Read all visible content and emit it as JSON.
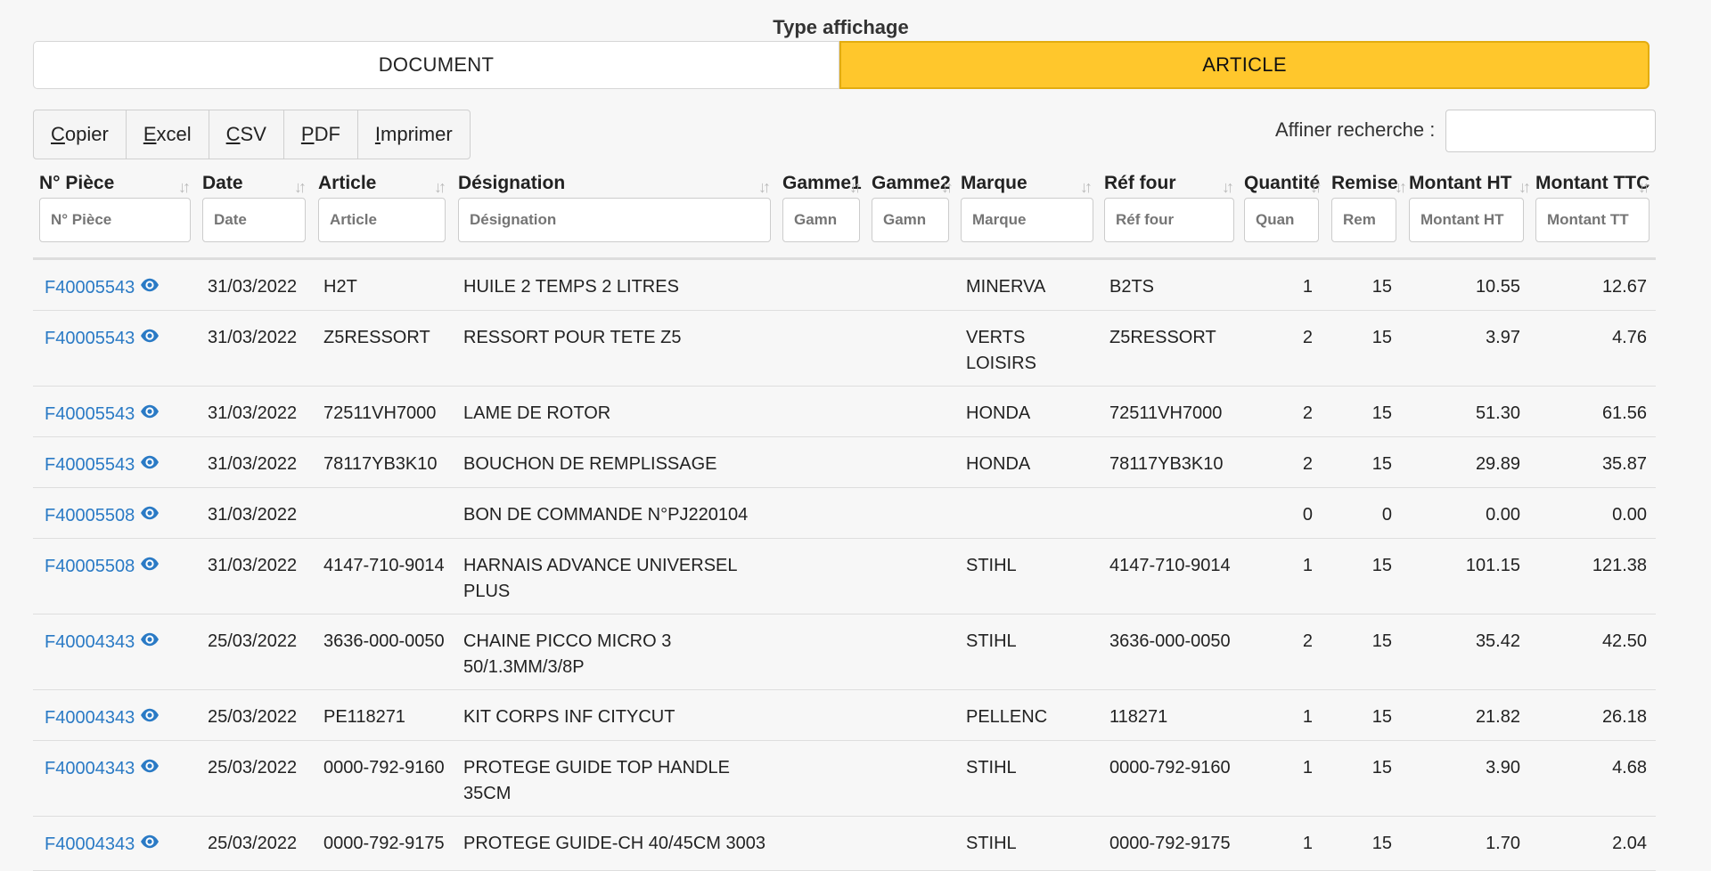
{
  "view_type": {
    "title": "Type affichage",
    "document_label": "DOCUMENT",
    "article_label": "ARTICLE",
    "selected": "ARTICLE",
    "accent_color": "#ffc72c"
  },
  "toolbar": {
    "buttons": [
      {
        "ul": "C",
        "rest": "opier"
      },
      {
        "ul": "E",
        "rest": "xcel"
      },
      {
        "ul": "C",
        "rest": "SV"
      },
      {
        "ul": "P",
        "rest": "DF"
      },
      {
        "ul": "I",
        "rest": "mprimer"
      }
    ]
  },
  "search": {
    "label": "Affiner recherche :",
    "value": ""
  },
  "table": {
    "headers": [
      "N° Pièce",
      "Date",
      "Article",
      "Désignation",
      "Gamme1",
      "Gamme2",
      "Marque",
      "Réf four",
      "Quantité",
      "Remise",
      "Montant HT",
      "Montant TTC"
    ],
    "filter_placeholders": [
      "N° Pièce",
      "Date",
      "Article",
      "Désignation",
      "Gamn",
      "Gamn",
      "Marque",
      "Réf four",
      "Quan",
      "Rem",
      "Montant HT",
      "Montant TT"
    ],
    "rows": [
      {
        "piece": "F40005543",
        "date": "31/03/2022",
        "article": "H2T",
        "designation": "HUILE 2 TEMPS 2 LITRES",
        "gamme1": "",
        "gamme2": "",
        "marque": "MINERVA",
        "ref": "B2TS",
        "qte": "1",
        "remise": "15",
        "ht": "10.55",
        "ttc": "12.67"
      },
      {
        "piece": "F40005543",
        "date": "31/03/2022",
        "article": "Z5RESSORT",
        "designation": "RESSORT POUR TETE Z5",
        "gamme1": "",
        "gamme2": "",
        "marque": "VERTS LOISIRS",
        "ref": "Z5RESSORT",
        "qte": "2",
        "remise": "15",
        "ht": "3.97",
        "ttc": "4.76"
      },
      {
        "piece": "F40005543",
        "date": "31/03/2022",
        "article": "72511VH7000",
        "designation": "LAME DE ROTOR",
        "gamme1": "",
        "gamme2": "",
        "marque": "HONDA",
        "ref": "72511VH7000",
        "qte": "2",
        "remise": "15",
        "ht": "51.30",
        "ttc": "61.56"
      },
      {
        "piece": "F40005543",
        "date": "31/03/2022",
        "article": "78117YB3K10",
        "designation": "BOUCHON DE REMPLISSAGE",
        "gamme1": "",
        "gamme2": "",
        "marque": "HONDA",
        "ref": "78117YB3K10",
        "qte": "2",
        "remise": "15",
        "ht": "29.89",
        "ttc": "35.87"
      },
      {
        "piece": "F40005508",
        "date": "31/03/2022",
        "article": "",
        "designation": "BON DE COMMANDE N°PJ220104",
        "gamme1": "",
        "gamme2": "",
        "marque": "",
        "ref": "",
        "qte": "0",
        "remise": "0",
        "ht": "0.00",
        "ttc": "0.00"
      },
      {
        "piece": "F40005508",
        "date": "31/03/2022",
        "article": "4147-710-9014",
        "designation": "HARNAIS ADVANCE UNIVERSEL PLUS",
        "gamme1": "",
        "gamme2": "",
        "marque": "STIHL",
        "ref": "4147-710-9014",
        "qte": "1",
        "remise": "15",
        "ht": "101.15",
        "ttc": "121.38"
      },
      {
        "piece": "F40004343",
        "date": "25/03/2022",
        "article": "3636-000-0050",
        "designation": "CHAINE PICCO MICRO 3 50/1.3MM/3/8P",
        "gamme1": "",
        "gamme2": "",
        "marque": "STIHL",
        "ref": "3636-000-0050",
        "qte": "2",
        "remise": "15",
        "ht": "35.42",
        "ttc": "42.50"
      },
      {
        "piece": "F40004343",
        "date": "25/03/2022",
        "article": "PE118271",
        "designation": "KIT CORPS INF CITYCUT",
        "gamme1": "",
        "gamme2": "",
        "marque": "PELLENC",
        "ref": "118271",
        "qte": "1",
        "remise": "15",
        "ht": "21.82",
        "ttc": "26.18"
      },
      {
        "piece": "F40004343",
        "date": "25/03/2022",
        "article": "0000-792-9160",
        "designation": "PROTEGE GUIDE TOP HANDLE 35CM",
        "gamme1": "",
        "gamme2": "",
        "marque": "STIHL",
        "ref": "0000-792-9160",
        "qte": "1",
        "remise": "15",
        "ht": "3.90",
        "ttc": "4.68"
      },
      {
        "piece": "F40004343",
        "date": "25/03/2022",
        "article": "0000-792-9175",
        "designation": "PROTEGE GUIDE-CH 40/45CM 3003",
        "gamme1": "",
        "gamme2": "",
        "marque": "STIHL",
        "ref": "0000-792-9175",
        "qte": "1",
        "remise": "15",
        "ht": "1.70",
        "ttc": "2.04"
      }
    ]
  }
}
